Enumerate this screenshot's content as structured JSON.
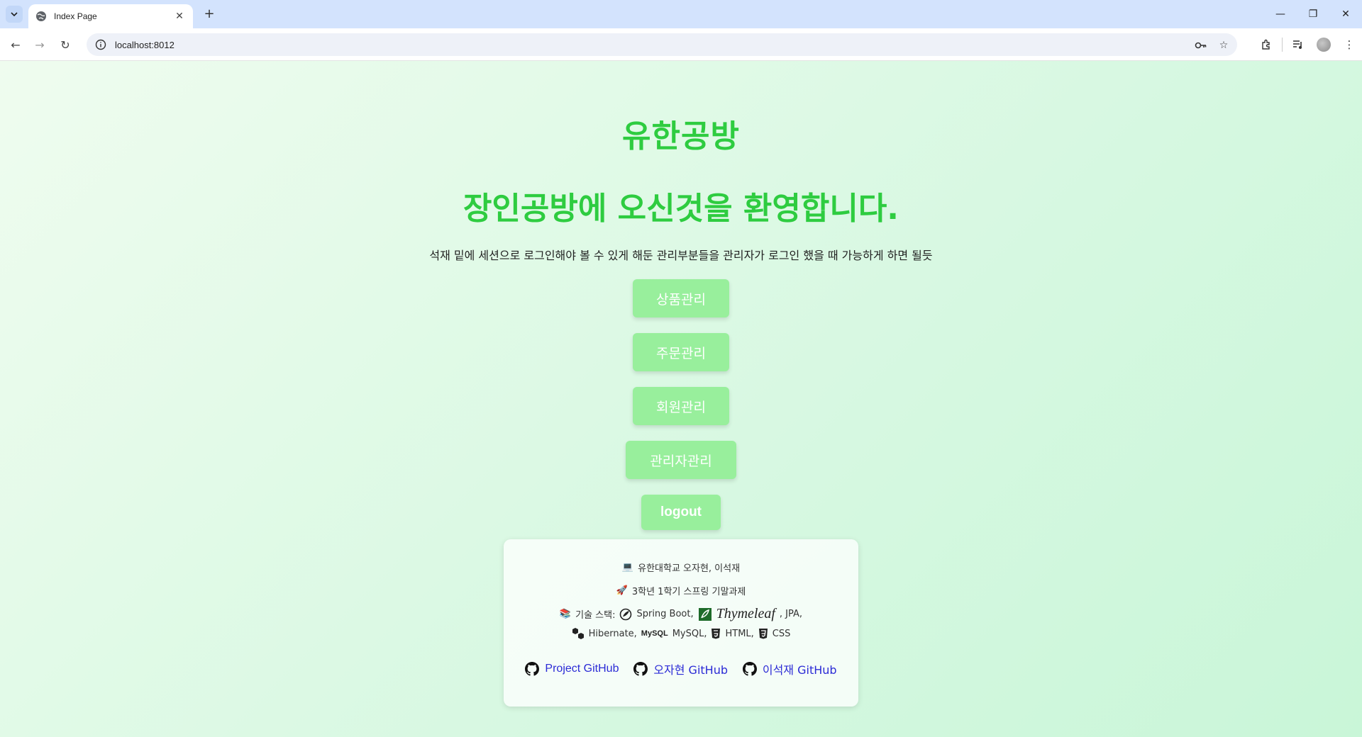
{
  "browser": {
    "tab_title": "Index Page",
    "url": "localhost:8012"
  },
  "page": {
    "site_title": "유한공방",
    "welcome": "장인공방에 오신것을 환영합니다.",
    "note": "석재 밑에 세션으로 로그인해야 볼 수 있게 해둔 관리부분들을 관리자가 로그인 했을 때 가능하게 하면 될듯",
    "buttons": {
      "product": "상품관리",
      "order": "주문관리",
      "member": "회원관리",
      "admin": "관리자관리",
      "logout": "logout"
    }
  },
  "info": {
    "team": "유한대학교 오자현, 이석재",
    "project": "3학년 1학기 스프링 기말과제",
    "stack_label": "기술 스택:",
    "spring": "Spring Boot,",
    "thymeleaf": "Thymeleaf",
    "jpa": ", JPA,",
    "hibernate": "Hibernate,",
    "mysql_logo": "MySQL",
    "mysql": "MySQL,",
    "html": "HTML,",
    "css": "CSS",
    "links": {
      "project": "Project GitHub",
      "oja": "오자현 GitHub",
      "lee": "이석재 GitHub"
    }
  },
  "colors": {
    "title": "#2ecc40",
    "button": "#98ef9c",
    "link": "#2b2bd6"
  }
}
